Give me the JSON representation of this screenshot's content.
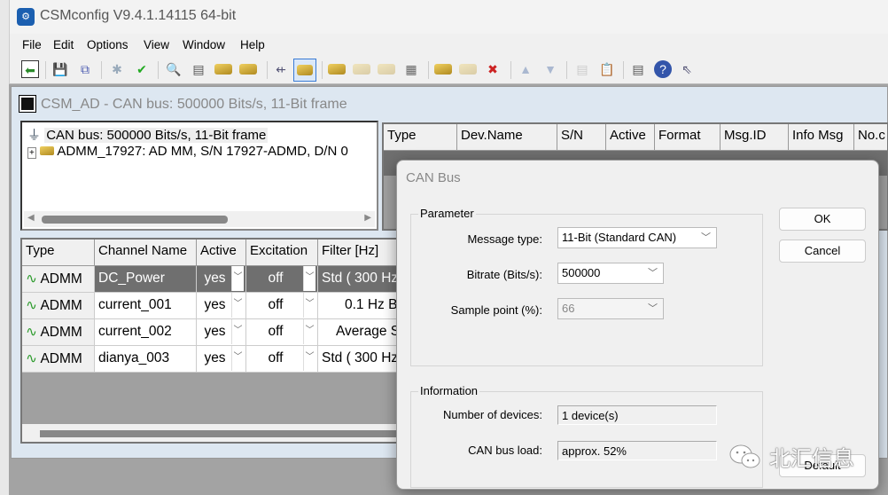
{
  "app": {
    "title": "CSMconfig V9.4.1.14115 64-bit"
  },
  "menu": [
    "File",
    "Edit",
    "Options",
    "View",
    "Window",
    "Help"
  ],
  "child": {
    "title": "CSM_AD - CAN bus: 500000 Bits/s, 11-Bit frame"
  },
  "tree": {
    "root": "CAN bus: 500000 Bits/s, 11-Bit frame",
    "device": "ADMM_17927: AD MM, S/N 17927-ADMD, D/N 0"
  },
  "upper_table": {
    "columns": [
      "Type",
      "Dev.Name",
      "S/N",
      "Active",
      "Format",
      "Msg.ID",
      "Info Msg",
      "No.c"
    ]
  },
  "lower_table": {
    "columns": [
      "Type",
      "Channel Name",
      "Active",
      "Excitation",
      "Filter [Hz]"
    ],
    "rows": [
      {
        "type": "ADMM",
        "name": "DC_Power",
        "active": "yes",
        "excitation": "off",
        "filter": "Std ( 300 Hz"
      },
      {
        "type": "ADMM",
        "name": "current_001",
        "active": "yes",
        "excitation": "off",
        "filter": "0.1 Hz B"
      },
      {
        "type": "ADMM",
        "name": "current_002",
        "active": "yes",
        "excitation": "off",
        "filter": "Average S"
      },
      {
        "type": "ADMM",
        "name": "dianya_003",
        "active": "yes",
        "excitation": "off",
        "filter": "Std ( 300 Hz"
      }
    ]
  },
  "dialog": {
    "title": "CAN Bus",
    "parameter_group": "Parameter",
    "message_type_label": "Message type:",
    "message_type": "11-Bit (Standard CAN)",
    "bitrate_label": "Bitrate (Bits/s):",
    "bitrate": "500000",
    "sample_point_label": "Sample point (%):",
    "sample_point": "66",
    "information_group": "Information",
    "devices_label": "Number of devices:",
    "devices": "1 device(s)",
    "bus_load_label": "CAN bus load:",
    "bus_load": "approx. 52%",
    "ok": "OK",
    "cancel": "Cancel",
    "default": "Default"
  },
  "watermark": "北汇信息",
  "colors": {
    "selected_row": "#6f6f6f",
    "accent": "#3a7bd5"
  }
}
